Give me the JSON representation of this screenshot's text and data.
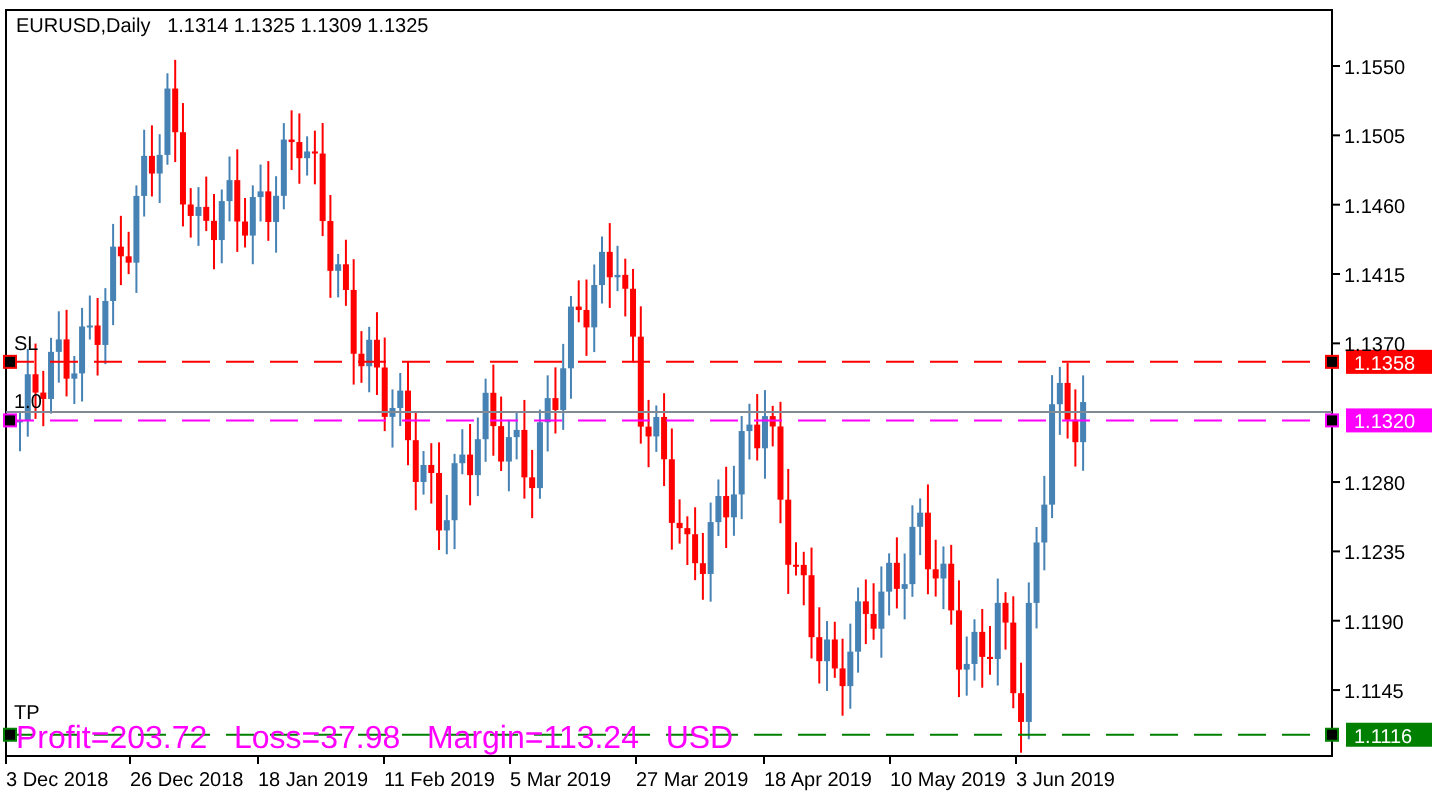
{
  "chart": {
    "symbol": "EURUSD,Daily",
    "ohlc": "1.1314 1.1325 1.1309 1.1325",
    "price_axis": [
      "1.1550",
      "1.1505",
      "1.1460",
      "1.1415",
      "1.1370",
      "1.1280",
      "1.1235",
      "1.1190",
      "1.1145"
    ],
    "time_axis": [
      "3 Dec 2018",
      "26 Dec 2018",
      "18 Jan 2019",
      "11 Feb 2019",
      "5 Mar 2019",
      "27 Mar 2019",
      "18 Apr 2019",
      "10 May 2019",
      "3 Jun 2019"
    ],
    "levels": [
      {
        "kind": "sl",
        "label": "SL",
        "price": "1.1358",
        "color": "#ff0000"
      },
      {
        "kind": "entry",
        "label": "1.0",
        "price": "1.1320",
        "color": "#ff00ff"
      },
      {
        "kind": "tp",
        "label": "TP",
        "price": "1.1116",
        "color": "#008000"
      }
    ],
    "summary": "Profit=203.72   Loss=37.98   Margin=113.24   USD"
  }
}
